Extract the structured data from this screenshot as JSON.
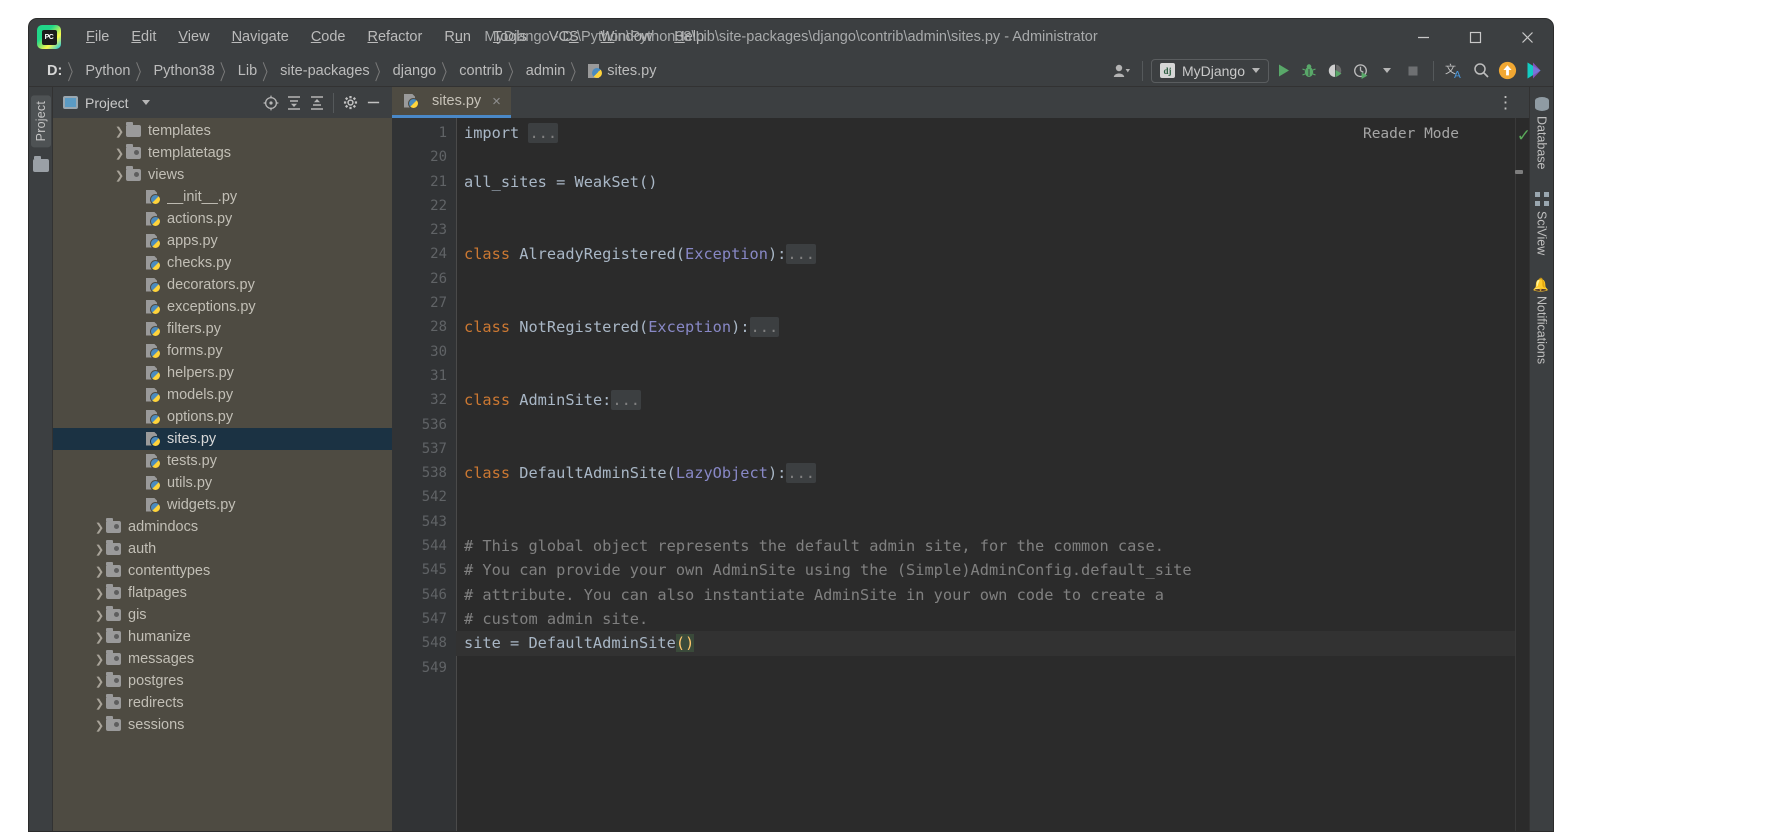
{
  "window": {
    "title": "MyDjango - D:\\Python\\Python38\\Lib\\site-packages\\django\\contrib\\admin\\sites.py - Administrator",
    "minimize_label": "—",
    "maximize_label": "□",
    "close_label": "✕",
    "logo_text": "PC"
  },
  "menubar": {
    "items": [
      {
        "label": "File",
        "mnemonic": "F"
      },
      {
        "label": "Edit",
        "mnemonic": "E"
      },
      {
        "label": "View",
        "mnemonic": "V"
      },
      {
        "label": "Navigate",
        "mnemonic": "N"
      },
      {
        "label": "Code",
        "mnemonic": "C"
      },
      {
        "label": "Refactor",
        "mnemonic": "R"
      },
      {
        "label": "Run",
        "mnemonic": "u"
      },
      {
        "label": "Tools",
        "mnemonic": "T"
      },
      {
        "label": "VCS",
        "mnemonic": "S"
      },
      {
        "label": "Window",
        "mnemonic": "W"
      },
      {
        "label": "Help",
        "mnemonic": "H"
      }
    ]
  },
  "breadcrumb": {
    "items": [
      "D:",
      "Python",
      "Python38",
      "Lib",
      "site-packages",
      "django",
      "contrib",
      "admin"
    ],
    "file": "sites.py",
    "separator": "〉"
  },
  "toolbar": {
    "profile_label": "",
    "run_config": "MyDjango",
    "run_config_icon": "django-icon",
    "buttons": [
      {
        "name": "run-button",
        "glyph": "▶"
      },
      {
        "name": "debug-button",
        "glyph": "bug"
      },
      {
        "name": "run-with-coverage-button",
        "glyph": "coverage"
      },
      {
        "name": "profile-button",
        "glyph": "profiler"
      },
      {
        "name": "stop-button",
        "glyph": "■"
      },
      {
        "name": "translate-button",
        "glyph": "文A"
      },
      {
        "name": "search-everywhere-button",
        "glyph": "🔍"
      },
      {
        "name": "update-button",
        "glyph": "↑"
      },
      {
        "name": "ide-features-button",
        "glyph": "▶"
      }
    ]
  },
  "sidebar": {
    "tool_tab": "Project",
    "panel_title": "Project",
    "actions": [
      {
        "name": "locate-file-button",
        "glyph": "⊕"
      },
      {
        "name": "expand-all-button",
        "glyph": "↓"
      },
      {
        "name": "collapse-all-button",
        "glyph": "↑"
      },
      {
        "name": "settings-gear-button",
        "glyph": "⚙"
      },
      {
        "name": "hide-panel-button",
        "glyph": "—"
      }
    ],
    "tree": [
      {
        "label": "templates",
        "type": "folder",
        "indent": 3,
        "arrow": true,
        "modified": false
      },
      {
        "label": "templatetags",
        "type": "folder",
        "indent": 3,
        "arrow": true,
        "modified": true
      },
      {
        "label": "views",
        "type": "folder",
        "indent": 3,
        "arrow": true,
        "modified": true
      },
      {
        "label": "__init__.py",
        "type": "py",
        "indent": 4,
        "arrow": false
      },
      {
        "label": "actions.py",
        "type": "py",
        "indent": 4,
        "arrow": false
      },
      {
        "label": "apps.py",
        "type": "py",
        "indent": 4,
        "arrow": false
      },
      {
        "label": "checks.py",
        "type": "py",
        "indent": 4,
        "arrow": false
      },
      {
        "label": "decorators.py",
        "type": "py",
        "indent": 4,
        "arrow": false
      },
      {
        "label": "exceptions.py",
        "type": "py",
        "indent": 4,
        "arrow": false
      },
      {
        "label": "filters.py",
        "type": "py",
        "indent": 4,
        "arrow": false
      },
      {
        "label": "forms.py",
        "type": "py",
        "indent": 4,
        "arrow": false
      },
      {
        "label": "helpers.py",
        "type": "py",
        "indent": 4,
        "arrow": false
      },
      {
        "label": "models.py",
        "type": "py",
        "indent": 4,
        "arrow": false
      },
      {
        "label": "options.py",
        "type": "py",
        "indent": 4,
        "arrow": false
      },
      {
        "label": "sites.py",
        "type": "py",
        "indent": 4,
        "arrow": false,
        "selected": true
      },
      {
        "label": "tests.py",
        "type": "py",
        "indent": 4,
        "arrow": false
      },
      {
        "label": "utils.py",
        "type": "py",
        "indent": 4,
        "arrow": false
      },
      {
        "label": "widgets.py",
        "type": "py",
        "indent": 4,
        "arrow": false
      },
      {
        "label": "admindocs",
        "type": "folder",
        "indent": 2,
        "arrow": true,
        "modified": true
      },
      {
        "label": "auth",
        "type": "folder",
        "indent": 2,
        "arrow": true,
        "modified": true
      },
      {
        "label": "contenttypes",
        "type": "folder",
        "indent": 2,
        "arrow": true,
        "modified": true
      },
      {
        "label": "flatpages",
        "type": "folder",
        "indent": 2,
        "arrow": true,
        "modified": true
      },
      {
        "label": "gis",
        "type": "folder",
        "indent": 2,
        "arrow": true,
        "modified": true
      },
      {
        "label": "humanize",
        "type": "folder",
        "indent": 2,
        "arrow": true,
        "modified": true
      },
      {
        "label": "messages",
        "type": "folder",
        "indent": 2,
        "arrow": true,
        "modified": true
      },
      {
        "label": "postgres",
        "type": "folder",
        "indent": 2,
        "arrow": true,
        "modified": true
      },
      {
        "label": "redirects",
        "type": "folder",
        "indent": 2,
        "arrow": true,
        "modified": true
      },
      {
        "label": "sessions",
        "type": "folder",
        "indent": 2,
        "arrow": true,
        "modified": true
      }
    ]
  },
  "editor": {
    "tab": {
      "label": "sites.py",
      "close_glyph": "×"
    },
    "options_glyph": "⋮",
    "reader_mode": "Reader Mode",
    "inspection_glyph": "✓",
    "lines": [
      {
        "num": "1",
        "fold": "plus",
        "segments": [
          {
            "t": "import ",
            "c": "plain"
          },
          {
            "t": "...",
            "c": "ph"
          }
        ]
      },
      {
        "num": "20",
        "fold": "",
        "segments": []
      },
      {
        "num": "21",
        "fold": "",
        "segments": [
          {
            "t": "all_sites = WeakSet()",
            "c": "plain"
          }
        ]
      },
      {
        "num": "22",
        "fold": "",
        "segments": []
      },
      {
        "num": "23",
        "fold": "",
        "segments": []
      },
      {
        "num": "24",
        "fold": "plus",
        "segments": [
          {
            "t": "class ",
            "c": "kw"
          },
          {
            "t": "AlreadyRegistered",
            "c": "cls"
          },
          {
            "t": "(",
            "c": "punct"
          },
          {
            "t": "Exception",
            "c": "base"
          },
          {
            "t": "):",
            "c": "punct"
          },
          {
            "t": "...",
            "c": "ph"
          }
        ]
      },
      {
        "num": "26",
        "fold": "",
        "segments": []
      },
      {
        "num": "27",
        "fold": "",
        "segments": []
      },
      {
        "num": "28",
        "fold": "plus",
        "segments": [
          {
            "t": "class ",
            "c": "kw"
          },
          {
            "t": "NotRegistered",
            "c": "cls"
          },
          {
            "t": "(",
            "c": "punct"
          },
          {
            "t": "Exception",
            "c": "base"
          },
          {
            "t": "):",
            "c": "punct"
          },
          {
            "t": "...",
            "c": "ph"
          }
        ]
      },
      {
        "num": "30",
        "fold": "",
        "segments": []
      },
      {
        "num": "31",
        "fold": "",
        "segments": []
      },
      {
        "num": "32",
        "fold": "plus",
        "segments": [
          {
            "t": "class ",
            "c": "kw"
          },
          {
            "t": "AdminSite",
            "c": "cls"
          },
          {
            "t": ":",
            "c": "punct"
          },
          {
            "t": "...",
            "c": "ph"
          }
        ]
      },
      {
        "num": "536",
        "fold": "",
        "segments": []
      },
      {
        "num": "537",
        "fold": "",
        "segments": []
      },
      {
        "num": "538",
        "fold": "plus",
        "segments": [
          {
            "t": "class ",
            "c": "kw"
          },
          {
            "t": "DefaultAdminSite",
            "c": "cls"
          },
          {
            "t": "(",
            "c": "punct"
          },
          {
            "t": "LazyObject",
            "c": "base"
          },
          {
            "t": "):",
            "c": "punct"
          },
          {
            "t": "...",
            "c": "ph"
          }
        ]
      },
      {
        "num": "542",
        "fold": "",
        "segments": []
      },
      {
        "num": "543",
        "fold": "",
        "segments": []
      },
      {
        "num": "544",
        "fold": "minus",
        "segments": [
          {
            "t": "# This global object represents the default admin site, for the common case.",
            "c": "cmt"
          }
        ]
      },
      {
        "num": "545",
        "fold": "",
        "segments": [
          {
            "t": "# You can provide your own AdminSite using the (Simple)AdminConfig.default_site",
            "c": "cmt"
          }
        ]
      },
      {
        "num": "546",
        "fold": "",
        "segments": [
          {
            "t": "# attribute. You can also instantiate AdminSite in your own code to create a",
            "c": "cmt"
          }
        ]
      },
      {
        "num": "547",
        "fold": "end",
        "segments": [
          {
            "t": "# custom admin site.",
            "c": "cmt"
          }
        ]
      },
      {
        "num": "548",
        "fold": "",
        "current": true,
        "segments": [
          {
            "t": "site = ",
            "c": "plain"
          },
          {
            "t": "DefaultAdminSite",
            "c": "plain"
          },
          {
            "t": "()",
            "c": "brk"
          }
        ]
      },
      {
        "num": "549",
        "fold": "",
        "segments": []
      }
    ]
  },
  "right_stripe": {
    "items": [
      {
        "label": "Database",
        "icon": "database-icon"
      },
      {
        "label": "SciView",
        "icon": "grid-icon"
      },
      {
        "label": "Notifications",
        "icon": "bell-icon"
      }
    ]
  },
  "colors": {
    "accent_blue": "#4a88c7",
    "selection": "#1b3243",
    "panel_bg": "#4e4b42",
    "editor_bg": "#2b2b2b",
    "chrome_bg": "#3c3f41",
    "keyword": "#cc7832",
    "base_class": "#8888c6",
    "comment": "#808080",
    "bracket_highlight": "#ffc66d"
  }
}
